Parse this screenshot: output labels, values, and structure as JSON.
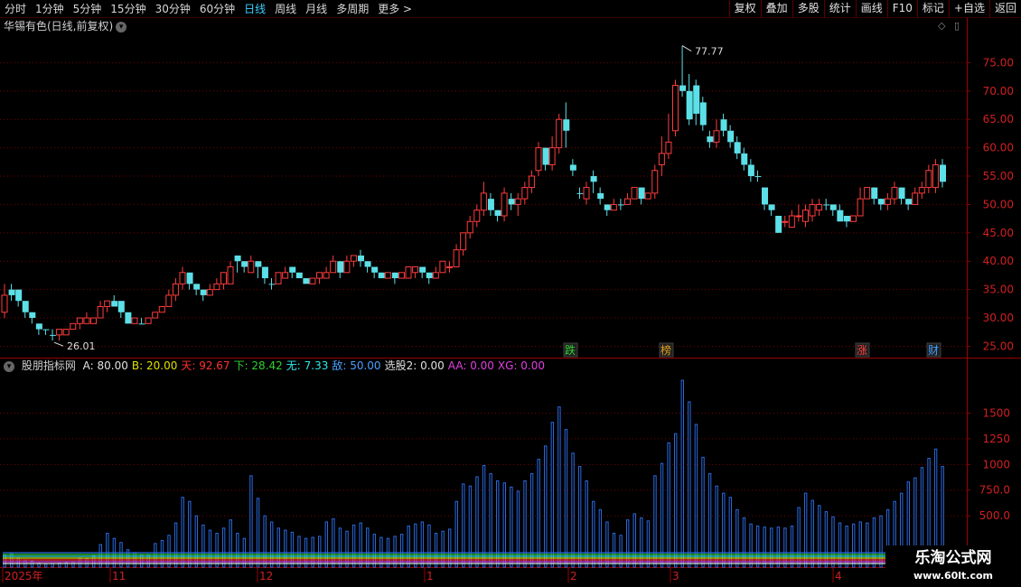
{
  "toolbar": {
    "periods": [
      "分时",
      "1分钟",
      "5分钟",
      "15分钟",
      "30分钟",
      "60分钟",
      "日线",
      "周线",
      "月线",
      "多周期",
      "更多 >"
    ],
    "active": "日线",
    "right_buttons": [
      "复权",
      "叠加",
      "多股",
      "统计",
      "画线",
      "F10",
      "标记",
      "+自选",
      "返回"
    ]
  },
  "stock": {
    "title": "华锡有色(日线,前复权)"
  },
  "price_axis": {
    "ticks": [
      "75.00",
      "70.00",
      "65.00",
      "60.00",
      "55.00",
      "50.00",
      "45.00",
      "40.00",
      "35.00",
      "30.00",
      "25.00"
    ]
  },
  "volume_axis": {
    "ticks": [
      "1500",
      "1250",
      "1000",
      "750.0",
      "500.0"
    ]
  },
  "annotations": {
    "high": "77.77",
    "low": "26.01"
  },
  "event_tags": [
    {
      "text": "跌",
      "color": "#30d030"
    },
    {
      "text": "榜",
      "color": "#e0a020"
    },
    {
      "text": "涨",
      "color": "#ff4040"
    },
    {
      "text": "财",
      "color": "#40a0ff"
    }
  ],
  "indicator": {
    "name": "股朋指标网",
    "values": [
      {
        "text": "A: 80.00",
        "color": "#e0e0e0"
      },
      {
        "text": "B: 20.00",
        "color": "#e0e000"
      },
      {
        "text": "天: 92.67",
        "color": "#ff3030"
      },
      {
        "text": "下: 28.42",
        "color": "#30d030"
      },
      {
        "text": "无: 7.33",
        "color": "#30e8e8"
      },
      {
        "text": "敌: 50.00",
        "color": "#4aa0ff"
      },
      {
        "text": "选股2: 0.00",
        "color": "#e0e0e0"
      },
      {
        "text": "AA: 0.00",
        "color": "#e040e0"
      },
      {
        "text": "XG: 0.00",
        "color": "#e040e0"
      }
    ]
  },
  "date_axis": {
    "labels": [
      "2025年",
      "11",
      "12",
      "1",
      "2",
      "3",
      "4"
    ]
  },
  "watermark": {
    "brand": "乐淘公式网",
    "url": "www.60lt.com"
  },
  "colors": {
    "up": "#ff3c3c",
    "down": "#5ce0e8",
    "grid": "#7a0000",
    "volume": "#2a6ae0"
  },
  "chart_data": {
    "type": "candlestick",
    "price_range": [
      23,
      80
    ],
    "volume_range": [
      0,
      1900
    ],
    "candles": [
      [
        31,
        34,
        36,
        30,
        "u",
        120
      ],
      [
        34,
        35,
        36,
        33,
        "d",
        130
      ],
      [
        35,
        33,
        34,
        32,
        "d",
        90
      ],
      [
        33,
        31,
        32,
        30,
        "d",
        70
      ],
      [
        31,
        30,
        31,
        29,
        "d",
        60
      ],
      [
        29,
        28,
        29,
        27,
        "d",
        40
      ],
      [
        28,
        28,
        28,
        27,
        "d",
        30
      ],
      [
        27,
        27,
        28,
        26,
        "d",
        35
      ],
      [
        27,
        28,
        28,
        26,
        "u",
        40
      ],
      [
        27,
        28,
        28,
        27,
        "u",
        45
      ],
      [
        28,
        29,
        29,
        28,
        "u",
        50
      ],
      [
        29,
        30,
        30,
        28,
        "u",
        90
      ],
      [
        29,
        30,
        31,
        29,
        "u",
        85
      ],
      [
        29,
        30,
        30,
        29,
        "u",
        110
      ],
      [
        30,
        32,
        33,
        30,
        "u",
        220
      ],
      [
        32,
        33,
        33,
        31,
        "u",
        330
      ],
      [
        33,
        32,
        34,
        32,
        "d",
        280
      ],
      [
        33,
        31,
        32,
        30,
        "d",
        240
      ],
      [
        31,
        29,
        30,
        29,
        "d",
        170
      ],
      [
        29,
        30,
        30,
        29,
        "u",
        140
      ],
      [
        29,
        29,
        30,
        29,
        "d",
        120
      ],
      [
        29,
        30,
        30,
        29,
        "u",
        120
      ],
      [
        30,
        31,
        31,
        30,
        "u",
        230
      ],
      [
        31,
        32,
        32,
        31,
        "u",
        260
      ],
      [
        32,
        34,
        35,
        32,
        "u",
        310
      ],
      [
        34,
        36,
        37,
        33,
        "u",
        430
      ],
      [
        36,
        38,
        39,
        35,
        "u",
        680
      ],
      [
        38,
        36,
        38,
        35,
        "d",
        640
      ],
      [
        36,
        35,
        36,
        34,
        "d",
        500
      ],
      [
        35,
        34,
        35,
        33,
        "d",
        410
      ],
      [
        34,
        35,
        36,
        34,
        "u",
        360
      ],
      [
        35,
        36,
        37,
        35,
        "u",
        330
      ],
      [
        36,
        38,
        38,
        35,
        "u",
        380
      ],
      [
        36,
        39,
        40,
        36,
        "u",
        460
      ],
      [
        40,
        41,
        41,
        38,
        "d",
        330
      ],
      [
        40,
        39,
        40,
        38,
        "d",
        280
      ],
      [
        38,
        40,
        41,
        38,
        "u",
        890
      ],
      [
        40,
        39,
        40,
        37,
        "d",
        670
      ],
      [
        39,
        37,
        39,
        36,
        "d",
        500
      ],
      [
        36,
        36,
        37,
        35,
        "d",
        440
      ],
      [
        36,
        38,
        38,
        36,
        "u",
        380
      ],
      [
        37,
        38,
        39,
        37,
        "u",
        360
      ],
      [
        39,
        38,
        39,
        37,
        "d",
        340
      ],
      [
        38,
        37,
        38,
        37,
        "d",
        300
      ],
      [
        37,
        36,
        37,
        36,
        "d",
        280
      ],
      [
        36,
        37,
        37,
        36,
        "u",
        290
      ],
      [
        37,
        38,
        38,
        36,
        "u",
        300
      ],
      [
        37,
        38,
        39,
        37,
        "u",
        440
      ],
      [
        38,
        40,
        41,
        38,
        "u",
        470
      ],
      [
        40,
        38,
        40,
        37,
        "d",
        380
      ],
      [
        38,
        40,
        41,
        38,
        "u",
        350
      ],
      [
        40,
        41,
        41,
        39,
        "u",
        410
      ],
      [
        41,
        40,
        42,
        39,
        "d",
        430
      ],
      [
        40,
        39,
        40,
        38,
        "d",
        380
      ],
      [
        39,
        38,
        39,
        37,
        "d",
        320
      ],
      [
        38,
        37,
        38,
        37,
        "d",
        290
      ],
      [
        37,
        38,
        38,
        37,
        "u",
        280
      ],
      [
        38,
        37,
        38,
        36,
        "d",
        300
      ],
      [
        37,
        38,
        38,
        37,
        "u",
        320
      ],
      [
        37,
        39,
        39,
        37,
        "u",
        400
      ],
      [
        38,
        39,
        39,
        37,
        "u",
        420
      ],
      [
        39,
        38,
        39,
        37,
        "d",
        440
      ],
      [
        38,
        37,
        38,
        36,
        "d",
        410
      ],
      [
        37,
        38,
        39,
        37,
        "u",
        330
      ],
      [
        38,
        40,
        40,
        38,
        "u",
        350
      ],
      [
        39,
        39,
        40,
        38,
        "u",
        370
      ],
      [
        39,
        42,
        43,
        39,
        "u",
        640
      ],
      [
        42,
        45,
        45,
        41,
        "u",
        810
      ],
      [
        45,
        47,
        48,
        44,
        "u",
        790
      ],
      [
        47,
        49,
        50,
        46,
        "u",
        880
      ],
      [
        49,
        52,
        54,
        48,
        "u",
        990
      ],
      [
        51,
        49,
        52,
        48,
        "d",
        910
      ],
      [
        49,
        48,
        49,
        47,
        "d",
        840
      ],
      [
        48,
        52,
        53,
        47,
        "u",
        820
      ],
      [
        51,
        50,
        52,
        49,
        "d",
        780
      ],
      [
        50,
        51,
        52,
        48,
        "u",
        740
      ],
      [
        51,
        53,
        54,
        50,
        "u",
        840
      ],
      [
        53,
        55,
        56,
        52,
        "u",
        910
      ],
      [
        56,
        60,
        61,
        55,
        "u",
        1050
      ],
      [
        60,
        57,
        60,
        56,
        "d",
        1180
      ],
      [
        57,
        60,
        62,
        56,
        "u",
        1410
      ],
      [
        60,
        65,
        66,
        59,
        "u",
        1560
      ],
      [
        65,
        63,
        68,
        60,
        "d",
        1340
      ],
      [
        57,
        56,
        58,
        55,
        "d",
        1110
      ],
      [
        52,
        52,
        53,
        51,
        "d",
        980
      ],
      [
        51,
        53,
        54,
        50,
        "u",
        840
      ],
      [
        54,
        55,
        56,
        52,
        "d",
        640
      ],
      [
        52,
        51,
        53,
        50,
        "d",
        560
      ],
      [
        50,
        49,
        50,
        48,
        "d",
        440
      ],
      [
        49,
        50,
        51,
        49,
        "u",
        330
      ],
      [
        50,
        50,
        51,
        49,
        "d",
        310
      ],
      [
        50,
        51,
        52,
        50,
        "u",
        460
      ],
      [
        51,
        53,
        53,
        51,
        "u",
        520
      ],
      [
        53,
        51,
        53,
        50,
        "d",
        480
      ],
      [
        51,
        52,
        52,
        51,
        "u",
        450
      ],
      [
        52,
        56,
        57,
        51,
        "u",
        890
      ],
      [
        57,
        59,
        62,
        55,
        "u",
        1010
      ],
      [
        59,
        61,
        66,
        58,
        "u",
        1210
      ],
      [
        63,
        71,
        72,
        62,
        "u",
        1300
      ],
      [
        71,
        70,
        78,
        69,
        "d",
        1820
      ],
      [
        70,
        65,
        73,
        64,
        "d",
        1610
      ],
      [
        71,
        66,
        72,
        64,
        "d",
        1390
      ],
      [
        68,
        64,
        69,
        63,
        "d",
        1070
      ],
      [
        62,
        61,
        63,
        60,
        "d",
        910
      ],
      [
        61,
        63,
        65,
        60,
        "u",
        790
      ],
      [
        65,
        63,
        66,
        62,
        "d",
        720
      ],
      [
        63,
        61,
        64,
        60,
        "d",
        680
      ],
      [
        61,
        59,
        62,
        58,
        "d",
        560
      ],
      [
        59,
        57,
        60,
        56,
        "d",
        480
      ],
      [
        57,
        55,
        58,
        54,
        "d",
        420
      ],
      [
        55,
        55,
        56,
        54,
        "d",
        400
      ],
      [
        53,
        50,
        53,
        49,
        "d",
        390
      ],
      [
        50,
        49,
        50,
        48,
        "d",
        380
      ],
      [
        48,
        45,
        48,
        45,
        "d",
        390
      ],
      [
        47,
        47,
        48,
        46,
        "u",
        380
      ],
      [
        46,
        48,
        49,
        46,
        "u",
        400
      ],
      [
        48,
        48,
        50,
        47,
        "u",
        580
      ],
      [
        47,
        49,
        50,
        46,
        "u",
        720
      ],
      [
        48,
        50,
        51,
        47,
        "u",
        650
      ],
      [
        49,
        50,
        51,
        48,
        "u",
        600
      ],
      [
        50,
        50,
        51,
        49,
        "d",
        540
      ],
      [
        50,
        49,
        50,
        48,
        "d",
        490
      ],
      [
        49,
        47,
        50,
        47,
        "d",
        430
      ],
      [
        48,
        47,
        48,
        46,
        "d",
        400
      ],
      [
        47,
        48,
        48,
        47,
        "u",
        420
      ],
      [
        48,
        51,
        53,
        48,
        "u",
        440
      ],
      [
        51,
        53,
        53,
        51,
        "u",
        430
      ],
      [
        53,
        51,
        53,
        50,
        "d",
        480
      ],
      [
        51,
        50,
        51,
        49,
        "d",
        500
      ],
      [
        50,
        51,
        52,
        49,
        "u",
        560
      ],
      [
        51,
        53,
        54,
        50,
        "u",
        640
      ],
      [
        53,
        51,
        53,
        50,
        "d",
        720
      ],
      [
        51,
        50,
        51,
        49,
        "d",
        830
      ],
      [
        50,
        52,
        53,
        50,
        "u",
        870
      ],
      [
        52,
        53,
        54,
        51,
        "u",
        970
      ],
      [
        53,
        56,
        57,
        52,
        "u",
        1060
      ],
      [
        53,
        57,
        58,
        52,
        "u",
        1150
      ],
      [
        57,
        54,
        58,
        53,
        "d",
        980
      ]
    ]
  }
}
